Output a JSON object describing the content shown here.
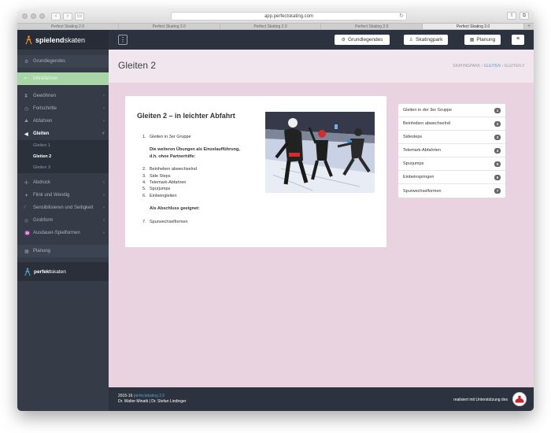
{
  "browser": {
    "url": "app.perfectskating.com",
    "tabs": [
      {
        "label": "Perfect Skating 2.0",
        "active": false
      },
      {
        "label": "Perfect Skating 2.0",
        "active": false
      },
      {
        "label": "Perfect Skating 2.0",
        "active": false
      },
      {
        "label": "Perfect Skating 2.0",
        "active": false
      },
      {
        "label": "Perfect Skating 2.0",
        "active": true
      }
    ],
    "plus": "+"
  },
  "brand": {
    "bold": "spielend",
    "rest": "skaten"
  },
  "topbar": {
    "menu_icon": "⋮",
    "grundlegendes": "Grundlegendes",
    "skatingpark": "Skatingpark",
    "planung": "Planung",
    "list_icon": "≡"
  },
  "sidebar": {
    "grundlegendes": "Grundlegendes",
    "highlight": "Inlinefahren",
    "items": [
      {
        "label": "Gewöhnen",
        "icon": "⧗"
      },
      {
        "label": "Fortschritte",
        "icon": "◷"
      },
      {
        "label": "Abfahren",
        "icon": "⛰"
      },
      {
        "label": "Gleiten",
        "icon": "◀",
        "active": true
      }
    ],
    "sub_items": [
      {
        "label": "Gleiten 1"
      },
      {
        "label": "Gleiten 2",
        "active": true
      },
      {
        "label": "Gleiten 3"
      }
    ],
    "items2": [
      {
        "label": "Abdruck",
        "icon": "✣"
      },
      {
        "label": "Flink und Wendig",
        "icon": "✦"
      },
      {
        "label": "Sensibilisieren und Seitigkeit",
        "icon": "⁄"
      },
      {
        "label": "Grobform",
        "icon": "◎"
      },
      {
        "label": "Ausdauer-Spielformen",
        "icon": "♒"
      }
    ],
    "planung": "Planung",
    "perfekt": {
      "bold": "perfekt",
      "rest": "skaten"
    }
  },
  "main": {
    "title": "Gleiten 2",
    "breadcrumb": {
      "root": "SKATINGPARK",
      "parent": "GLEITEN",
      "current": "GLEITEN 2"
    },
    "card": {
      "title": "Gleiten 2 – in leichter Abfahrt",
      "list": [
        {
          "num": "1.",
          "text": "Gleiten in 3er Gruppe"
        },
        {
          "bold1": "Die weiteren Übungen als Einzelaufführung,",
          "bold2": "d.h. ohne Partnerhilfe:"
        },
        {
          "num": "2.",
          "text": "Beinheben abwechselnd"
        },
        {
          "num": "3.",
          "text": "Side Steps"
        },
        {
          "num": "4.",
          "text": "Telemark-Abfahren"
        },
        {
          "num": "5.",
          "text": "Spurjumps"
        },
        {
          "num": "6.",
          "text": "Einbeingleiten"
        },
        {
          "bold": "Als Abschluss geeignet:"
        },
        {
          "num": "7.",
          "text": "Spurwechselformen"
        }
      ]
    },
    "right_list": [
      {
        "label": "Gleiten in der 3er Gruppe",
        "n": "1"
      },
      {
        "label": "Beinheben abwechselnd",
        "n": "2"
      },
      {
        "label": "Sidesteps",
        "n": "3"
      },
      {
        "label": "Telemark-Abfahrten",
        "n": "4"
      },
      {
        "label": "Spurjumps",
        "n": "5"
      },
      {
        "label": "Einbeinspringen",
        "n": "6"
      },
      {
        "label": "Spurwechselformen",
        "n": "7"
      }
    ]
  },
  "footer": {
    "year": "2015-16",
    "product": "perfectskating 2.0",
    "author1": "Dr. Walter Minatti",
    "sep": "|",
    "author2": "Dr. Stefan Lindinger",
    "support": "realisiert mit Unterstützung des"
  }
}
